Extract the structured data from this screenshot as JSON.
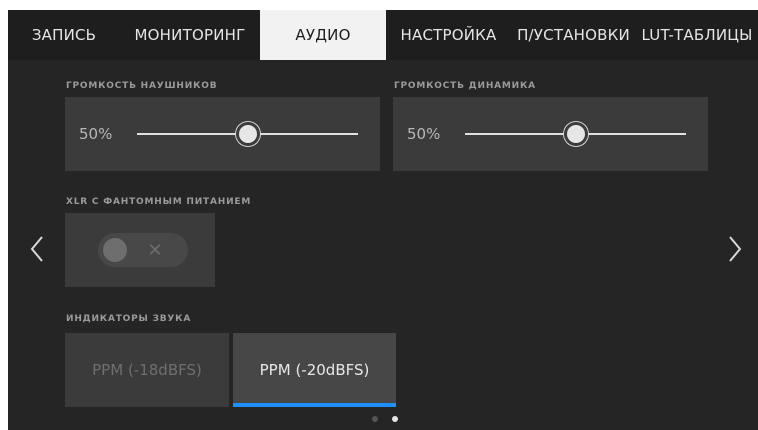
{
  "tabs": [
    {
      "label": "ЗАПИСЬ",
      "active": false
    },
    {
      "label": "МОНИТОРИНГ",
      "active": false
    },
    {
      "label": "АУДИО",
      "active": true
    },
    {
      "label": "НАСТРОЙКА",
      "active": false
    },
    {
      "label": "П/УСТАНОВКИ",
      "active": false
    },
    {
      "label": "LUT-ТАБЛИЦЫ",
      "active": false
    }
  ],
  "headphone_volume": {
    "label": "ГРОМКОСТЬ НАУШНИКОВ",
    "value_text": "50%",
    "level": 0.5
  },
  "speaker_volume": {
    "label": "ГРОМКОСТЬ ДИНАМИКА",
    "value_text": "50%",
    "level": 0.5
  },
  "xlr_phantom": {
    "label": "XLR С ФАНТОМНЫМ ПИТАНИЕМ",
    "enabled": false,
    "off_symbol": "✕"
  },
  "audio_meters": {
    "label": "ИНДИКАТОРЫ ЗВУКА",
    "options": [
      {
        "label": "PPM (-18dBFS)",
        "selected": false
      },
      {
        "label": "PPM (-20dBFS)",
        "selected": true
      }
    ]
  },
  "pagination": {
    "pages": 2,
    "current": 2
  },
  "icons": {
    "prev": "chevron-left-icon",
    "next": "chevron-right-icon"
  },
  "colors": {
    "accent": "#1e8fff",
    "background": "#252525",
    "panel": "#3b3b3b",
    "active_tab": "#f2f2f2"
  }
}
